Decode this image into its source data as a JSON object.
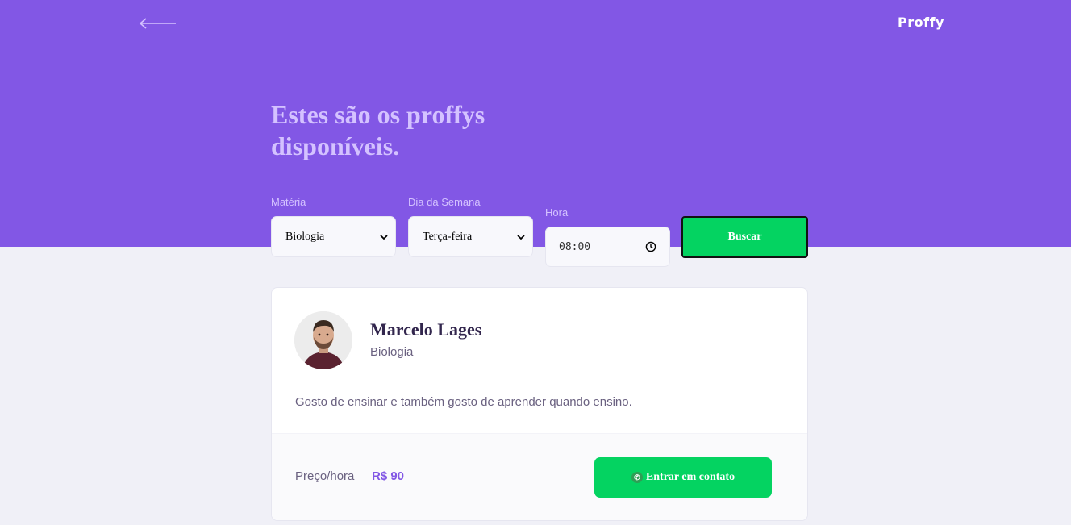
{
  "header": {
    "logo": "Proffy",
    "back_icon": "arrow-left-icon"
  },
  "hero": {
    "title_line1": "Estes são os proffys",
    "title_line2": "disponíveis."
  },
  "filters": {
    "subject": {
      "label": "Matéria",
      "value": "Biologia"
    },
    "weekday": {
      "label": "Dia da Semana",
      "value": "Terça-feira"
    },
    "time": {
      "label": "Hora",
      "value": "08:00"
    },
    "search_label": "Buscar"
  },
  "teacher": {
    "name": "Marcelo Lages",
    "subject": "Biologia",
    "bio": "Gosto de ensinar e também gosto de aprender quando ensino.",
    "price_label": "Preço/hora",
    "price_value": "R$ 90",
    "contact_label": "Entrar em contato",
    "contact_icon": "whatsapp-icon"
  },
  "colors": {
    "primary": "#8257e5",
    "secondary": "#04d361",
    "background": "#f0f0f7"
  }
}
